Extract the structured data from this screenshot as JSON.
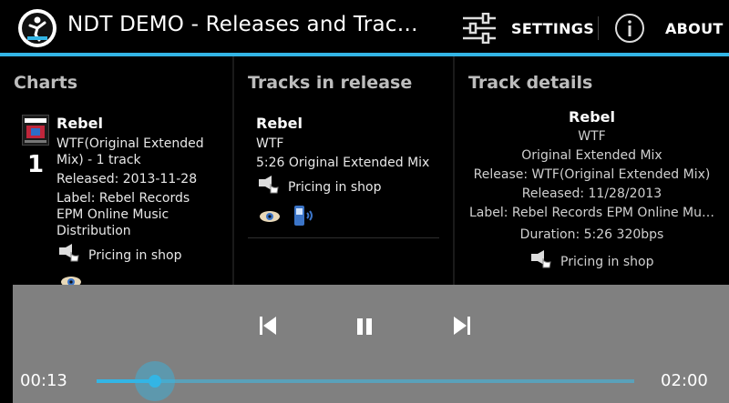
{
  "actionbar": {
    "title": "NDT DEMO - Releases and Trac…",
    "settings_label": "SETTINGS",
    "about_label": "ABOUT"
  },
  "charts": {
    "header": "Charts",
    "rank": "1",
    "item_title": "Rebel",
    "item_release": "WTF(Original Extended",
    "item_release_2": "Mix) - 1 track",
    "released": "Released: 2013-11-28",
    "label": "Label: Rebel Records",
    "label_2": "EPM Online Music",
    "label_3": "Distribution",
    "pricing": "Pricing in shop"
  },
  "tracks": {
    "header": "Tracks in release",
    "artist": "Rebel",
    "title": "WTF",
    "duration_mix": "5:26 Original Extended Mix",
    "pricing": "Pricing in shop"
  },
  "details": {
    "header": "Track details",
    "artist": "Rebel",
    "title": "WTF",
    "mix": "Original Extended Mix",
    "release": "Release: WTF(Original Extended Mix)",
    "released": "Released: 11/28/2013",
    "label": "Label: Rebel Records EPM Online Mu…",
    "duration": "Duration: 5:26 320bps",
    "pricing": "Pricing in shop"
  },
  "player": {
    "elapsed": "00:13",
    "total": "02:00",
    "progress": 0.108,
    "state": "playing"
  },
  "colors": {
    "accent": "#33b5e5",
    "player_bg": "#808080"
  },
  "icons": [
    "app-logo-icon",
    "settings-sliders-icon",
    "info-icon",
    "shop-speaker-icon",
    "eye-icon",
    "phone-icon",
    "skip-previous-icon",
    "pause-icon",
    "skip-next-icon"
  ]
}
